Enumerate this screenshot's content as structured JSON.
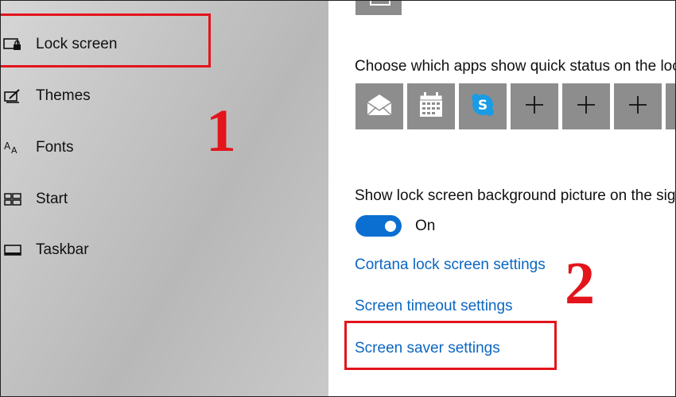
{
  "sidebar": {
    "items": [
      {
        "label": "Lock screen",
        "icon": "lock-screen-icon"
      },
      {
        "label": "Themes",
        "icon": "themes-icon"
      },
      {
        "label": "Fonts",
        "icon": "fonts-icon"
      },
      {
        "label": "Start",
        "icon": "start-icon"
      },
      {
        "label": "Taskbar",
        "icon": "taskbar-icon"
      }
    ]
  },
  "annotations": {
    "step1": "1",
    "step2": "2",
    "highlight_color": "#e3141b"
  },
  "main": {
    "quick_status_heading": "Choose which apps show quick status on the loc",
    "quick_status_tiles": [
      "mail-icon",
      "calendar-icon",
      "skype-icon",
      "plus-icon",
      "plus-icon",
      "plus-icon",
      "plus-icon"
    ],
    "background_heading": "Show lock screen background picture on the sign",
    "toggle_state": "On",
    "links": {
      "cortana": "Cortana lock screen settings",
      "timeout": "Screen timeout settings",
      "screensaver": "Screen saver settings"
    },
    "accent_color": "#0b6fd1",
    "link_color": "#0b67c2"
  }
}
